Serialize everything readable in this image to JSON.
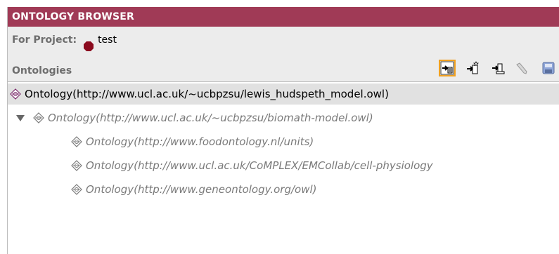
{
  "header": {
    "title": "ONTOLOGY BROWSER"
  },
  "project": {
    "label": "For Project:",
    "name": "test",
    "icon": "hexagon-icon",
    "icon_color": "#8b0a1e"
  },
  "ontologies": {
    "label": "Ontologies",
    "toolbar": [
      {
        "name": "create-ontology-button",
        "icon": "create-ontology-icon"
      },
      {
        "name": "add-import-button",
        "icon": "add-import-icon"
      },
      {
        "name": "import-from-file-button",
        "icon": "import-from-file-icon"
      },
      {
        "name": "edit-button",
        "icon": "pencil-icon"
      },
      {
        "name": "save-button",
        "icon": "save-icon"
      }
    ]
  },
  "tree": [
    {
      "label": "Ontology(http://www.ucl.ac.uk/~ucbpzsu/lewis_hudspeth_model.owl)",
      "level": 0,
      "selected": true,
      "expanded": null
    },
    {
      "label": "Ontology(http://www.ucl.ac.uk/~ucbpzsu/biomath-model.owl)",
      "level": 1,
      "selected": false,
      "expanded": true
    },
    {
      "label": "Ontology(http://www.foodontology.nl/units)",
      "level": 2,
      "selected": false,
      "expanded": null
    },
    {
      "label": "Ontology(http://www.ucl.ac.uk/CoMPLEX/EMCollab/cell-physiology",
      "level": 2,
      "selected": false,
      "expanded": null
    },
    {
      "label": "Ontology(http://www.geneontology.org/owl)",
      "level": 2,
      "selected": false,
      "expanded": null
    }
  ],
  "colors": {
    "header_bg": "#a03a56",
    "panel_bg": "#ececec",
    "selected_bg": "#e1e1e1"
  }
}
